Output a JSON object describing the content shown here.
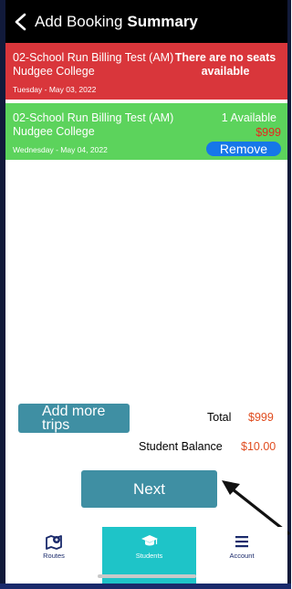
{
  "header": {
    "back_label": "Add Booking",
    "title": "Summary"
  },
  "bookings": [
    {
      "route": "02-School Run Billing Test (AM)",
      "school": "Nudgee College",
      "date": "Tuesday - May 03, 2022",
      "status": "There are no seats available",
      "color": "#d9363b"
    },
    {
      "route": "02-School Run Billing Test (AM)",
      "school": "Nudgee College",
      "date": "Wednesday - May 04, 2022",
      "status": "1 Available",
      "price": "$999",
      "remove_label": "Remove",
      "color": "#5cd35c"
    }
  ],
  "summary": {
    "add_more_label": "Add more trips",
    "total_label": "Total",
    "total_value": "$999",
    "balance_label": "Student Balance",
    "balance_value": "$10.00"
  },
  "next_label": "Next",
  "tabs": [
    {
      "label": "Routes",
      "icon": "map-pin-icon"
    },
    {
      "label": "Students",
      "icon": "graduation-cap-icon",
      "active": true
    },
    {
      "label": "Account",
      "icon": "menu-icon"
    }
  ],
  "colors": {
    "accent": "#3f8fa3",
    "active_tab": "#1ec4c8",
    "price": "#e04c1f",
    "nav": "#1a2a6b"
  }
}
